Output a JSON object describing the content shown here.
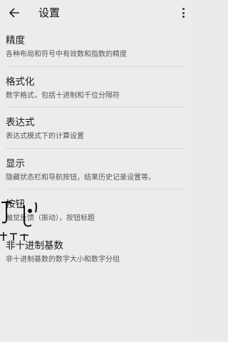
{
  "appbar": {
    "title": "设置",
    "back_icon": "arrow-back-icon",
    "more_icon": "more-vert-icon"
  },
  "items": [
    {
      "title": "精度",
      "subtitle": "各种布局和符号中有效数和指数的精度"
    },
    {
      "title": "格式化",
      "subtitle": "数字格式，包括十进制和千位分隔符"
    },
    {
      "title": "表达式",
      "subtitle": "表达式模式下的计算设置"
    },
    {
      "title": "显示",
      "subtitle": "隐藏状态栏和导航按钮，结果历史记录设置等。"
    },
    {
      "title": "按钮",
      "subtitle": "触觉反馈（振动），按钮标题"
    },
    {
      "title": "非十进制基数",
      "subtitle": "非十进制基数的数字大小和数字分组"
    }
  ]
}
